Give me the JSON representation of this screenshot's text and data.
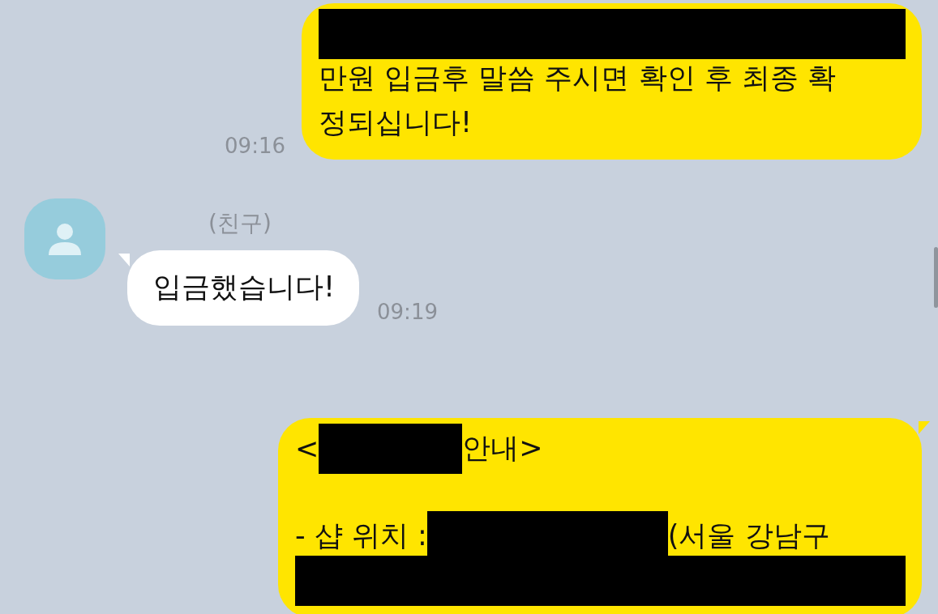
{
  "messages": [
    {
      "kind": "sent",
      "time": "09:16",
      "tail": false,
      "lines": [
        {
          "parts": [
            {
              "kind": "redacted"
            }
          ]
        },
        {
          "parts": [
            {
              "kind": "text",
              "text": "만원 입금후 말씀 주시면 확인 후 최종 확"
            }
          ]
        },
        {
          "parts": [
            {
              "kind": "text",
              "text": "정되십니다!"
            }
          ]
        }
      ]
    },
    {
      "kind": "received",
      "name": "(친구)",
      "time": "09:19",
      "tail": true,
      "lines": [
        {
          "parts": [
            {
              "kind": "text",
              "text": "입금했습니다!"
            }
          ]
        }
      ]
    },
    {
      "kind": "sent",
      "tail": true,
      "lines": [
        {
          "parts": [
            {
              "kind": "text",
              "text": "<"
            },
            {
              "kind": "redacted"
            },
            {
              "kind": "text",
              "text": "안내>"
            }
          ]
        },
        {
          "spaced": true,
          "parts": [
            {
              "kind": "text",
              "text": "- 샵 위치 : "
            },
            {
              "kind": "redacted"
            },
            {
              "kind": "text",
              "text": "(서울 강남구"
            }
          ]
        },
        {
          "parts": [
            {
              "kind": "redacted"
            }
          ]
        }
      ]
    }
  ]
}
